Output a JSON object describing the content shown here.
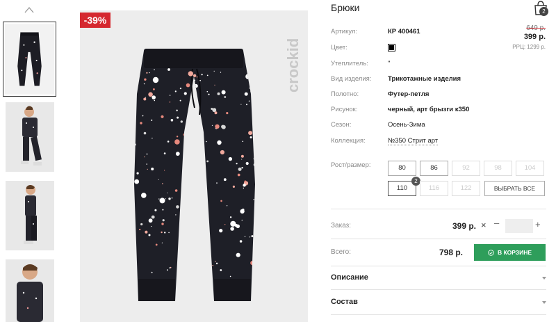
{
  "product": {
    "title": "Брюки",
    "discount_badge": "-39%",
    "brand": "crockid"
  },
  "cart": {
    "count": "2"
  },
  "specs": [
    {
      "label": "Артикул:",
      "value": "КР 400461"
    },
    {
      "label": "Цвет:",
      "value": ""
    },
    {
      "label": "Утеплитель:",
      "value": "\""
    },
    {
      "label": "Вид изделия:",
      "value": "Трикотажные изделия"
    },
    {
      "label": "Полотно:",
      "value": "Футер-петля"
    },
    {
      "label": "Рисунок:",
      "value": "черный, арт брызги к350"
    },
    {
      "label": "Сезон:",
      "value": "Осень-Зима"
    },
    {
      "label": "Коллекция:",
      "value": "№350 Стрит арт"
    }
  ],
  "pricing": {
    "old_price": "649 р.",
    "price": "399 р.",
    "rrp": "РРЦ: 1299 р."
  },
  "colors": {
    "swatch": "#000000",
    "accent_red": "#d5282f",
    "button_green": "#2e9e5b"
  },
  "sizes": {
    "label": "Рост/размер:",
    "items": [
      {
        "label": "80",
        "state": "available"
      },
      {
        "label": "86",
        "state": "available"
      },
      {
        "label": "92",
        "state": "unavailable"
      },
      {
        "label": "98",
        "state": "unavailable"
      },
      {
        "label": "104",
        "state": "unavailable"
      },
      {
        "label": "110",
        "state": "selected"
      },
      {
        "label": "116",
        "state": "unavailable"
      },
      {
        "label": "122",
        "state": "unavailable"
      }
    ],
    "selected_count": "2",
    "select_all": "ВЫБРАТЬ ВСЕ"
  },
  "order": {
    "label": "Заказ:",
    "price": "399 р.",
    "times": "×",
    "minus": "–",
    "plus": "+",
    "qty": ""
  },
  "total": {
    "label": "Всего:",
    "value": "798 р.",
    "button": "В КОРЗИНЕ"
  },
  "accordion": [
    {
      "label": "Описание",
      "icon": "chevron-down-icon"
    },
    {
      "label": "Состав",
      "icon": "chevron-down-icon"
    }
  ]
}
